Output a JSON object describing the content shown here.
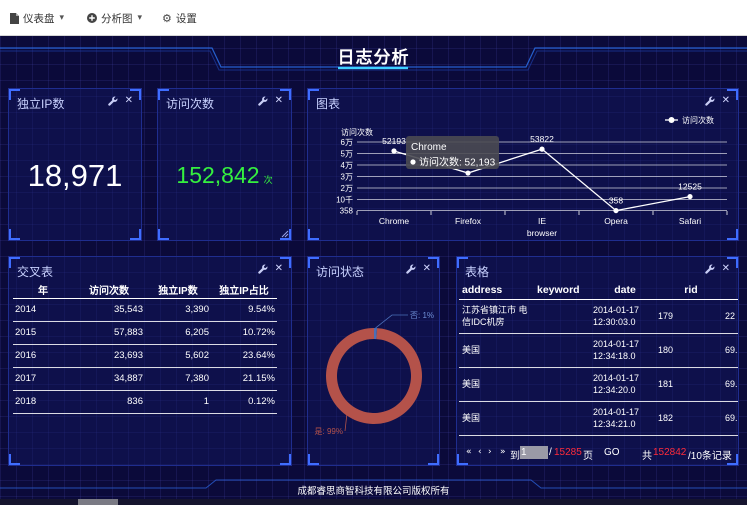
{
  "nav": {
    "items": [
      {
        "label": "仪表盘",
        "icon": "dashboard-icon"
      },
      {
        "label": "分析图",
        "icon": "chart-plus-icon"
      },
      {
        "label": "设置",
        "icon": "gear-icon"
      }
    ],
    "caret": "▾",
    "gear_glyph": "⚙"
  },
  "header": {
    "title": "日志分析"
  },
  "tools": {
    "close": "✕"
  },
  "panels": {
    "unique_ip": {
      "title": "独立IP数",
      "value": "18,971"
    },
    "visits": {
      "title": "访问次数",
      "value": "152,842",
      "unit": "次"
    },
    "chart": {
      "title": "图表"
    },
    "crosstab": {
      "title": "交叉表",
      "columns": [
        "年",
        "访问次数",
        "独立IP数",
        "独立IP占比"
      ],
      "rows": [
        [
          "2014",
          "35,543",
          "3,390",
          "9.54%"
        ],
        [
          "2015",
          "57,883",
          "6,205",
          "10.72%"
        ],
        [
          "2016",
          "23,693",
          "5,602",
          "23.64%"
        ],
        [
          "2017",
          "34,887",
          "7,380",
          "21.15%"
        ],
        [
          "2018",
          "836",
          "1",
          "0.12%"
        ]
      ]
    },
    "status": {
      "title": "访问状态"
    },
    "table": {
      "title": "表格",
      "columns": [
        "address",
        "keyword",
        "date",
        "rid",
        ""
      ],
      "rows": [
        [
          "江苏省镇江市 电信IDC机房",
          "",
          "2014-01-17 12:30:03.0",
          "179",
          "22"
        ],
        [
          "美国",
          "",
          "2014-01-17 12:34:18.0",
          "180",
          "69."
        ],
        [
          "美国",
          "",
          "2014-01-17 12:34:20.0",
          "181",
          "69."
        ],
        [
          "美国",
          "",
          "2014-01-17 12:34:21.0",
          "182",
          "69."
        ]
      ],
      "pager": {
        "first": "«",
        "prev": "‹",
        "next": "›",
        "last": "»",
        "goto_prefix": "到",
        "goto_value": "1",
        "separator": "/",
        "total_pages": "15285",
        "page_suffix": "页",
        "go": "GO",
        "total_prefix": "共",
        "total_records": "152842",
        "records_suffix": "/10条记录"
      }
    }
  },
  "chart_data": [
    {
      "type": "line",
      "categories": [
        "Chrome",
        "Firefox",
        "IE",
        "Opera",
        "Safari"
      ],
      "series": [
        {
          "name": "访问次数",
          "values": [
            52193,
            33000,
            53822,
            358,
            12525
          ],
          "data_labels": [
            "52193",
            "",
            "53822",
            "358",
            "12525"
          ],
          "color": "#ffffff"
        }
      ],
      "xlabel": "browser",
      "ylabel": "访问次数",
      "ylim": [
        0,
        60000
      ],
      "y_ticks": [
        {
          "value": 358,
          "label": "358"
        },
        {
          "value": 10000,
          "label": "10千"
        },
        {
          "value": 20000,
          "label": "2万"
        },
        {
          "value": 30000,
          "label": "3万"
        },
        {
          "value": 40000,
          "label": "4万"
        },
        {
          "value": 50000,
          "label": "5万"
        },
        {
          "value": 60000,
          "label": "6万"
        }
      ],
      "grid": true,
      "legend": "top-right",
      "tooltip": {
        "category": "Chrome",
        "text": "访问次数: 52,193"
      }
    },
    {
      "type": "pie",
      "donut": true,
      "slices": [
        {
          "name": "否",
          "value": 1,
          "label": "否: 1%",
          "color": "#4a6fb8"
        },
        {
          "name": "是",
          "value": 99,
          "label": "是: 99%",
          "color": "#b4524a"
        }
      ]
    }
  ],
  "footer": {
    "text": "成都睿思商智科技有限公司版权所有"
  },
  "colors": {
    "background": "#0b0a3a",
    "panel_border": "#1f2d8e",
    "panel_accent": "#3f6dff",
    "visits_value": "#35f03f",
    "pager_highlight": "#ff2b3a"
  }
}
